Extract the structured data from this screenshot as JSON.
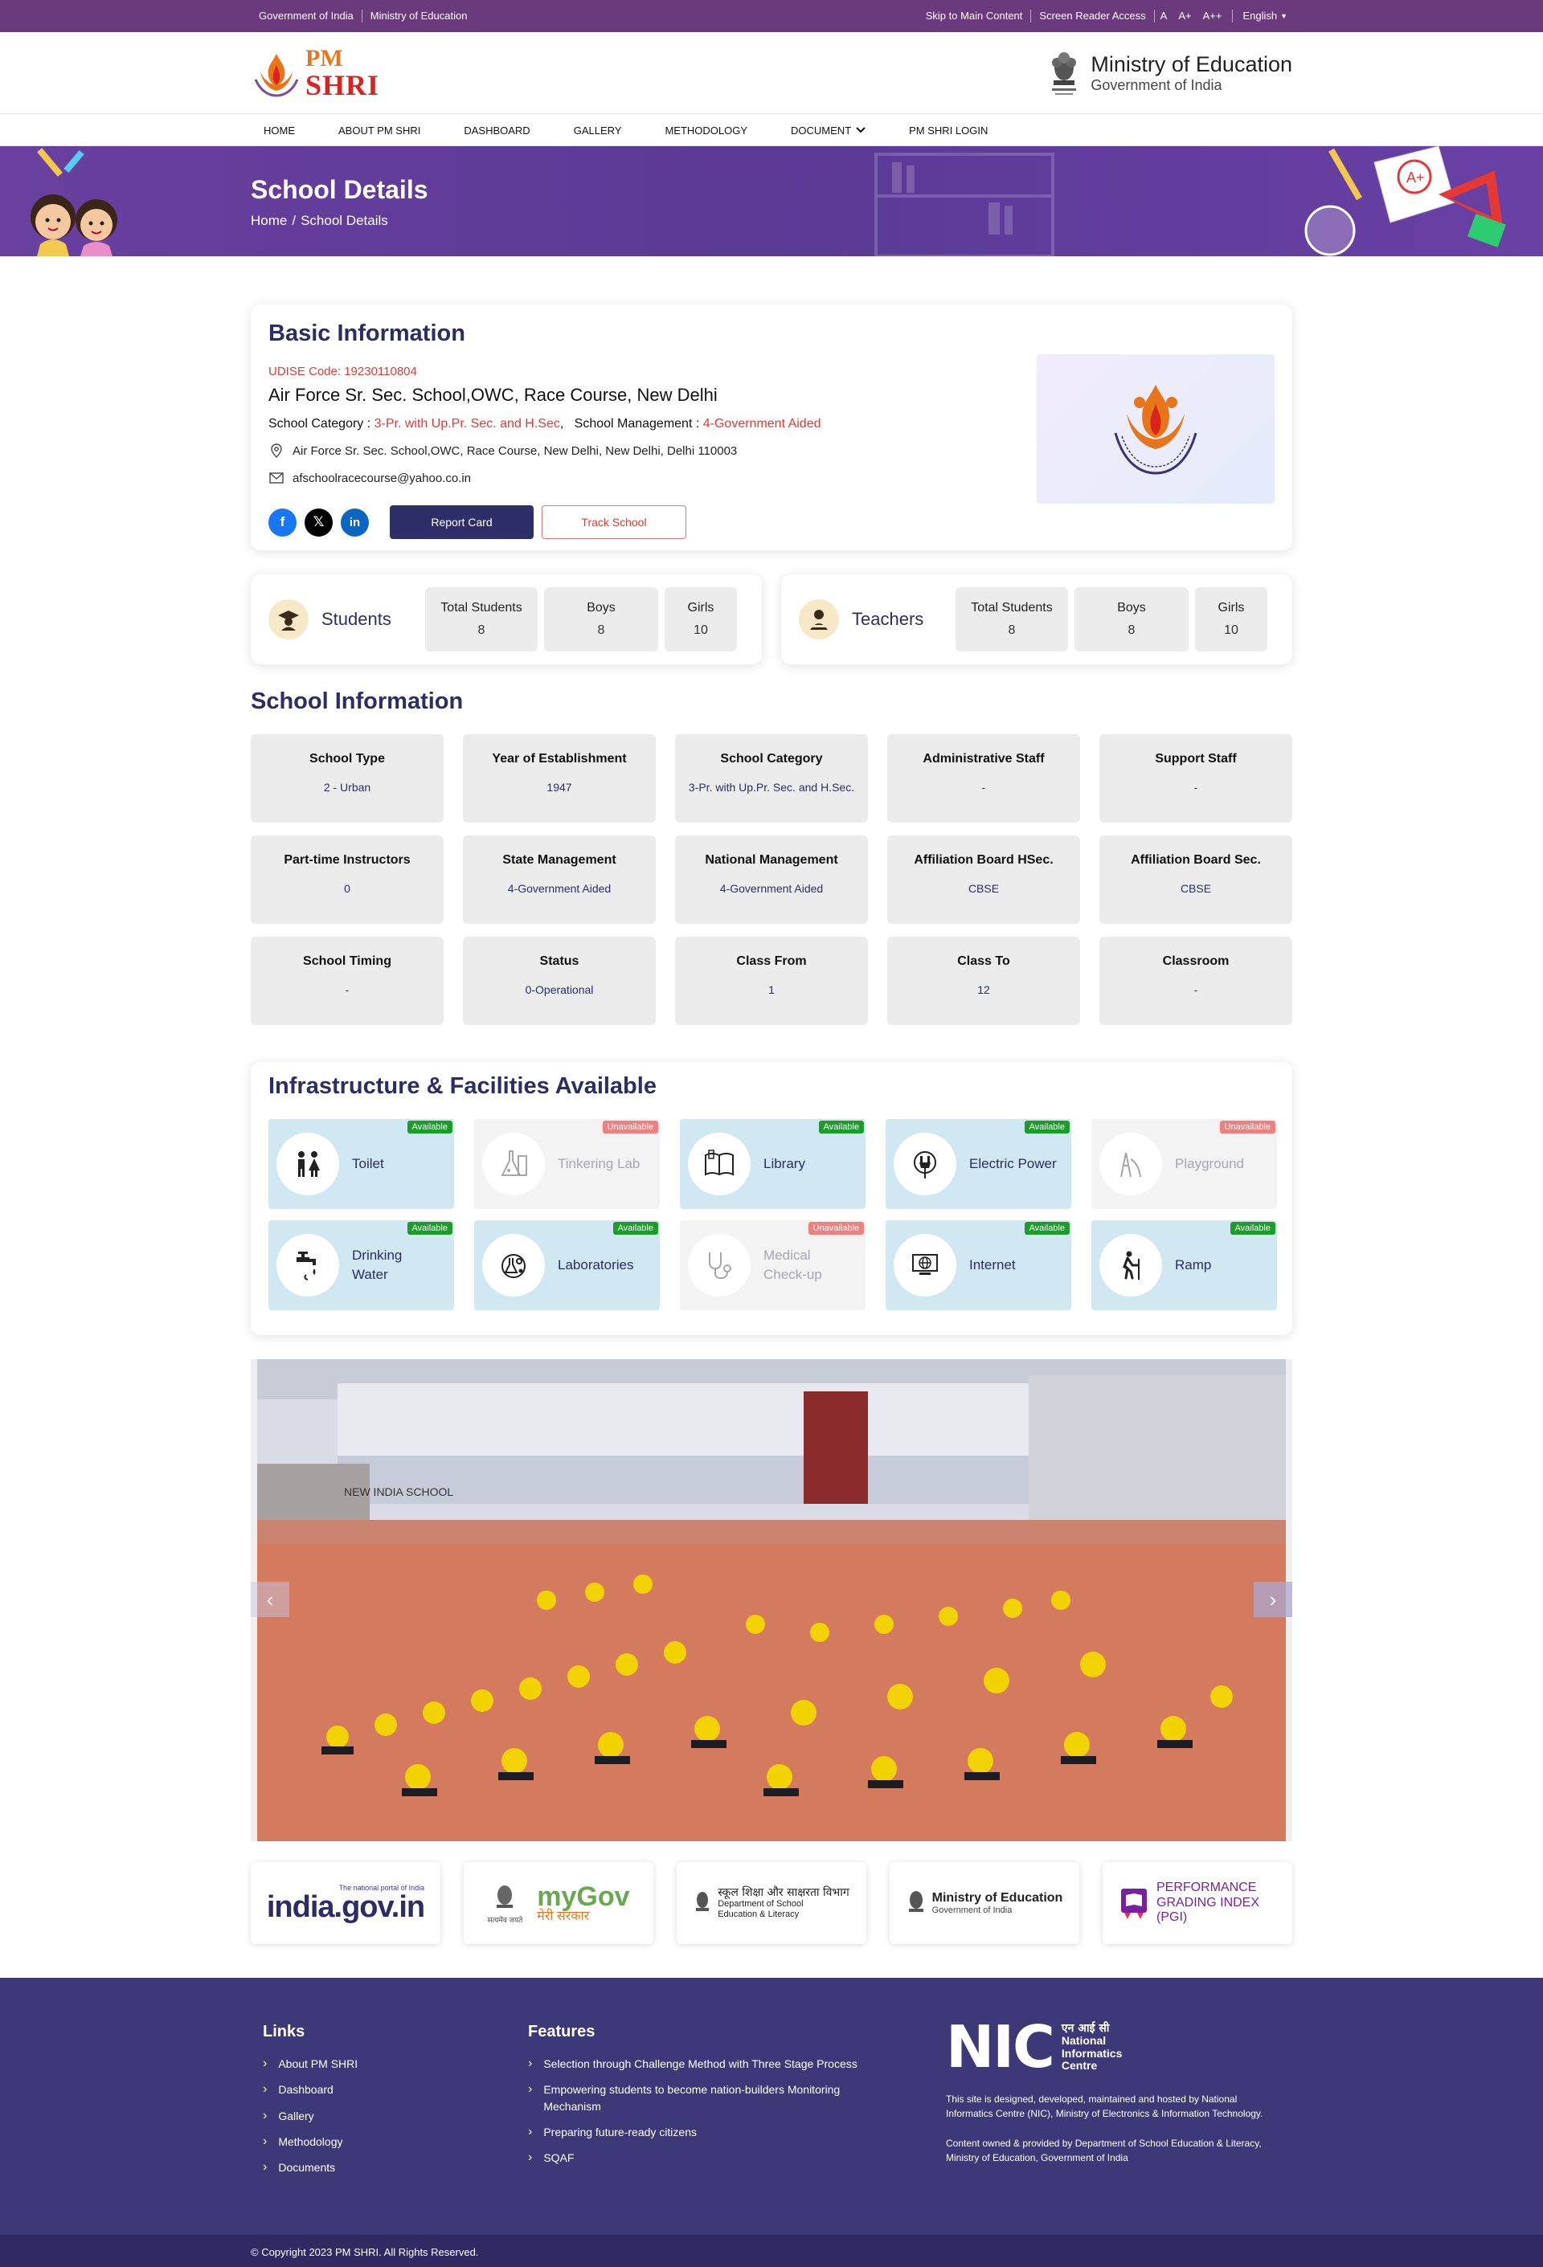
{
  "topbar": {
    "gov_india": "Government of India",
    "ministry": "Ministry of Education",
    "skip": "Skip to Main Content",
    "screen_reader": "Screen Reader Access",
    "font_small": "A",
    "font_medium": "A+",
    "font_large": "A++",
    "language": "English"
  },
  "header": {
    "logo_pm": "PM",
    "logo_shri": "SHRI",
    "ministry_title": "Ministry of Education",
    "ministry_sub": "Government of India"
  },
  "nav": {
    "items": [
      "HOME",
      "ABOUT PM SHRI",
      "DASHBOARD",
      "GALLERY",
      "METHODOLOGY",
      "DOCUMENT",
      "PM SHRI LOGIN"
    ]
  },
  "banner": {
    "title": "School Details",
    "crumb_home": "Home",
    "crumb_sep": "/",
    "crumb_current": "School Details"
  },
  "basic": {
    "heading": "Basic Information",
    "udise": "UDISE Code: 19230110804",
    "school_name": "Air Force Sr. Sec. School,OWC, Race Course, New Delhi",
    "category_label": "School Category :",
    "category_value": "3-Pr. with Up.Pr. Sec. and H.Sec",
    "management_label": "School Management :",
    "management_value": "4-Government Aided",
    "address": "Air Force Sr. Sec. School,OWC, Race Course, New Delhi, New Delhi, Delhi 110003",
    "email": "afschoolracecourse@yahoo.co.in",
    "report_card": "Report Card",
    "track_school": "Track School"
  },
  "students": {
    "label": "Students",
    "total_label": "Total Students",
    "total": "8",
    "boys_label": "Boys",
    "boys": "8",
    "girls_label": "Girls",
    "girls": "10"
  },
  "teachers": {
    "label": "Teachers",
    "total_label": "Total Students",
    "total": "8",
    "boys_label": "Boys",
    "boys": "8",
    "girls_label": "Girls",
    "girls": "10"
  },
  "school_info": {
    "heading": "School Information",
    "items": [
      {
        "title": "School Type",
        "value": "2 - Urban"
      },
      {
        "title": "Year of Establishment",
        "value": "1947"
      },
      {
        "title": "School Category",
        "value": "3-Pr. with Up.Pr. Sec. and H.Sec."
      },
      {
        "title": "Administrative Staff",
        "value": "-"
      },
      {
        "title": "Support Staff",
        "value": "-"
      },
      {
        "title": "Part-time Instructors",
        "value": "0"
      },
      {
        "title": "State Management",
        "value": "4-Government Aided"
      },
      {
        "title": "National Management",
        "value": "4-Government Aided"
      },
      {
        "title": "Affiliation Board HSec.",
        "value": "CBSE"
      },
      {
        "title": "Affiliation Board Sec.",
        "value": "CBSE"
      },
      {
        "title": "School Timing",
        "value": "-"
      },
      {
        "title": "Status",
        "value": "0-Operational"
      },
      {
        "title": "Class From",
        "value": "1"
      },
      {
        "title": "Class To",
        "value": "12"
      },
      {
        "title": "Classroom",
        "value": "-"
      }
    ]
  },
  "infra": {
    "heading": "Infrastructure & Facilities Available",
    "available_label": "Available",
    "unavailable_label": "Unavailable",
    "items": [
      {
        "name": "Toilet",
        "status": "Available",
        "icon": "toilet-icon"
      },
      {
        "name": "Tinkering Lab",
        "status": "Unavailable",
        "icon": "flask-icon"
      },
      {
        "name": "Library",
        "status": "Available",
        "icon": "book-icon"
      },
      {
        "name": "Electric Power",
        "status": "Available",
        "icon": "plug-icon"
      },
      {
        "name": "Playground",
        "status": "Unavailable",
        "icon": "playground-icon"
      },
      {
        "name": "Drinking Water",
        "status": "Available",
        "icon": "tap-icon"
      },
      {
        "name": "Laboratories",
        "status": "Available",
        "icon": "lab-icon"
      },
      {
        "name": "Medical Check-up",
        "status": "Unavailable",
        "icon": "stethoscope-icon"
      },
      {
        "name": "Internet",
        "status": "Available",
        "icon": "globe-icon"
      },
      {
        "name": "Ramp",
        "status": "Available",
        "icon": "ramp-icon"
      }
    ]
  },
  "carousel": {
    "prev": "‹",
    "next": "›",
    "wall_sign": "NEW INDIA SCHOOL"
  },
  "partners": {
    "indiagov_tag": "The national portal of India",
    "indiagov": "india.gov.in",
    "mygov": "myGov",
    "mygov_hindi": "मेरी सरकार",
    "emblem_caption": "सत्यमेव जयते",
    "dosel_hindi": "स्कूल शिक्षा और साक्षरता विभाग",
    "dosel_en": "Department of School Education & Literacy",
    "moe_title": "Ministry of Education",
    "moe_sub": "Government of India",
    "pgi": "PERFORMANCE GRADING INDEX (PGI)"
  },
  "footer": {
    "links_heading": "Links",
    "links": [
      "About PM SHRI",
      "Dashboard",
      "Gallery",
      "Methodology",
      "Documents"
    ],
    "features_heading": "Features",
    "features": [
      "Selection through Challenge Method with Three Stage Process",
      "Empowering students to become nation-builders Monitoring Mechanism",
      "Preparing future-ready citizens",
      "SQAF"
    ],
    "nic_hindi": "एन आई सी",
    "nic_name": "National Informatics Centre",
    "nic_logo": "NIC",
    "designed_by": "This site is designed, developed, maintained and hosted by National Informatics Centre (NIC), Ministry of Electronics & Information Technology.",
    "content_owned": "Content owned & provided by Department of School Education & Literacy, Ministry of Education, Government of India",
    "copyright": "© Copyright 2023 PM SHRI. All Rights Reserved."
  }
}
